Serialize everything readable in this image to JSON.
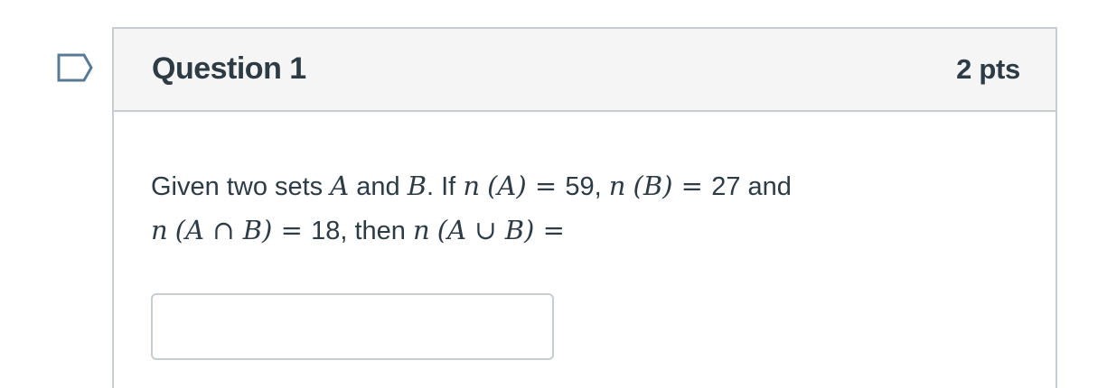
{
  "question": {
    "title": "Question 1",
    "points": "2 pts",
    "flag_icon": "bookmark-flag-icon",
    "text": {
      "t1": "Given two sets ",
      "A": "A",
      "and1": " and ",
      "B": "B",
      "t2": ". If ",
      "n1": "n",
      "expr1": "(A)",
      "eq1": " = ",
      "v1": "59, ",
      "n2": "n",
      "expr2": "(B)",
      "eq2": " = ",
      "v2": "27 and",
      "n3": "n",
      "expr3": "(A ∩ B)",
      "eq3": " = ",
      "v3": "18, then ",
      "n4": "n",
      "expr4": "(A ∪ B)",
      "eq4": " ="
    },
    "answer_value": ""
  }
}
